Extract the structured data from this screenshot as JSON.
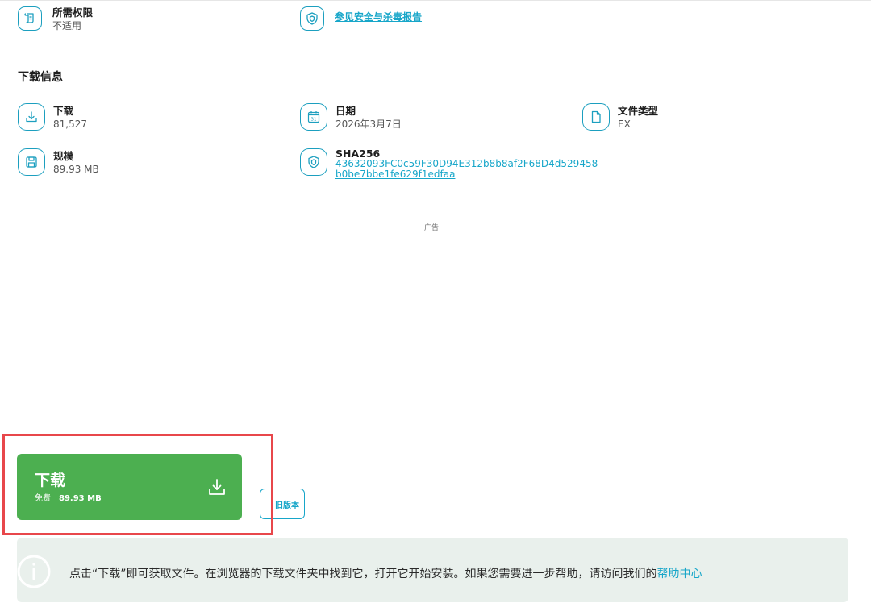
{
  "permissions": {
    "label": "所需权限",
    "value": "不适用"
  },
  "security": {
    "link": "参见安全与杀毒报告"
  },
  "download_info": {
    "title": "下载信息",
    "downloads": {
      "label": "下载",
      "value": "81,527"
    },
    "date": {
      "label": "日期",
      "value": "2026年3月7日"
    },
    "file_type": {
      "label": "文件类型",
      "value": "EX"
    },
    "size": {
      "label": "规模",
      "value": "89.93 MB"
    },
    "sha256": {
      "label": "SHA256",
      "line1": "43632093FC0c59F30D94E312b8b8af2F68D4d529458",
      "line2": "b0be7bbe1fe629f1edfaa"
    }
  },
  "ad_label": "广告",
  "download_button": {
    "title": "下载",
    "free": "免费",
    "size": "89.93 MB"
  },
  "old_versions_button": "旧版本",
  "notice": {
    "text": "点击“下载”即可获取文件。在浏览器的下载文件夹中找到它，打开它开始安装。如果您需要进一步帮助，请访问我们的",
    "link": "帮助中心"
  },
  "colors": {
    "accent": "#17a6c9",
    "download_green": "#4caf50",
    "highlight_red": "#e8474b",
    "notice_bg": "#e9f0ec"
  },
  "icons": [
    "scroll-icon",
    "shield-icon",
    "download-icon",
    "calendar-icon",
    "file-icon",
    "disk-icon",
    "info-icon"
  ]
}
